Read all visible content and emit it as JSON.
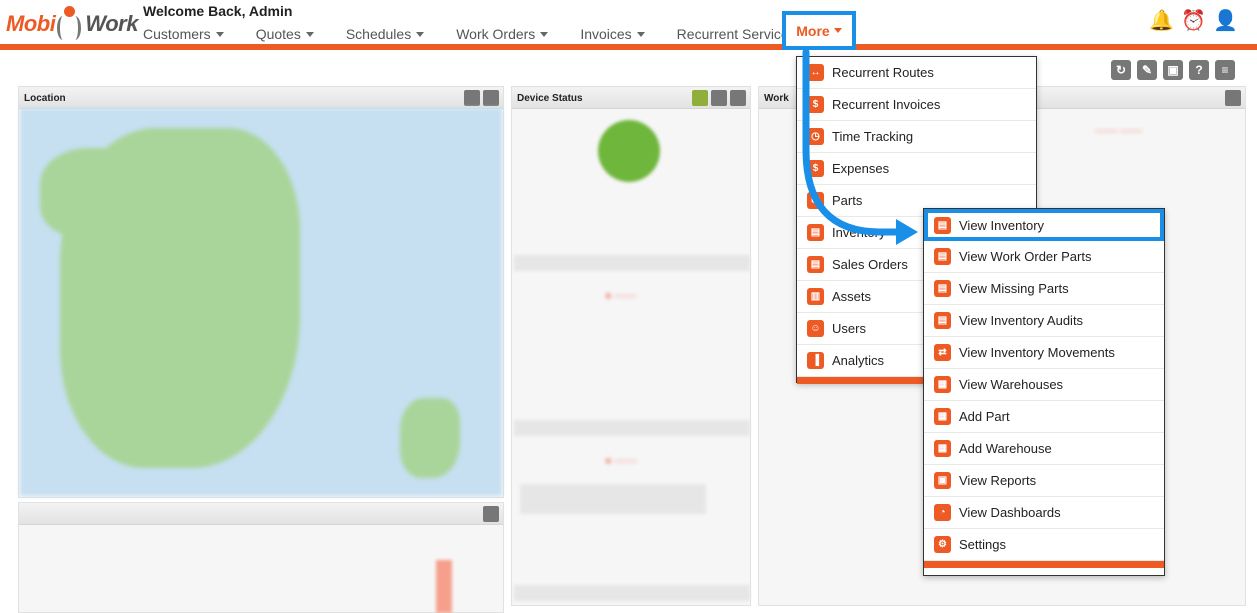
{
  "header": {
    "welcome": "Welcome Back,  Admin",
    "logo_left": "Mobi",
    "logo_right": "Work",
    "nav": [
      "Customers",
      "Quotes",
      "Schedules",
      "Work Orders",
      "Invoices",
      "Recurrent Services"
    ],
    "more_label": "More"
  },
  "panels": {
    "location": "Location",
    "device_status": "Device Status",
    "work": "Work"
  },
  "more_menu": [
    {
      "label": "Recurrent Routes",
      "icon": "route-icon"
    },
    {
      "label": "Recurrent Invoices",
      "icon": "dollar-icon"
    },
    {
      "label": "Time Tracking",
      "icon": "clock-icon"
    },
    {
      "label": "Expenses",
      "icon": "expense-icon"
    },
    {
      "label": "Parts",
      "icon": "parts-icon"
    },
    {
      "label": "Inventory",
      "icon": "inventory-icon"
    },
    {
      "label": "Sales Orders",
      "icon": "sales-order-icon"
    },
    {
      "label": "Assets",
      "icon": "assets-icon"
    },
    {
      "label": "Users",
      "icon": "users-icon"
    },
    {
      "label": "Analytics",
      "icon": "analytics-icon"
    }
  ],
  "inventory_menu": [
    {
      "label": "View Inventory",
      "icon": "inventory-icon"
    },
    {
      "label": "View Work Order Parts",
      "icon": "inventory-icon"
    },
    {
      "label": "View Missing Parts",
      "icon": "inventory-icon"
    },
    {
      "label": "View Inventory Audits",
      "icon": "inventory-icon"
    },
    {
      "label": "View Inventory Movements",
      "icon": "movements-icon"
    },
    {
      "label": "View Warehouses",
      "icon": "warehouse-icon"
    },
    {
      "label": "Add Part",
      "icon": "warehouse-icon"
    },
    {
      "label": "Add Warehouse",
      "icon": "warehouse-icon"
    },
    {
      "label": "View Reports",
      "icon": "reports-icon"
    },
    {
      "label": "View Dashboards",
      "icon": "dashboard-icon"
    },
    {
      "label": "Settings",
      "icon": "settings-icon"
    }
  ],
  "colors": {
    "accent": "#ee5a24",
    "highlight": "#1a8fe8"
  }
}
